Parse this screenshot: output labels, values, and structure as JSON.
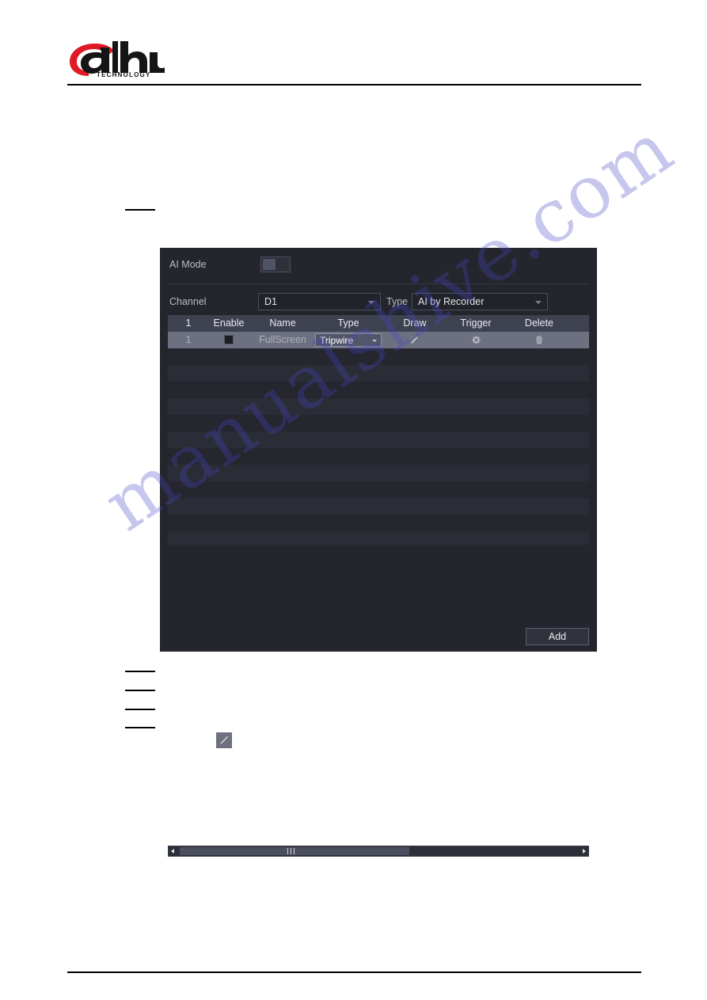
{
  "document": {
    "brand": "alhua",
    "brand_sub": "TECHNOLOGY"
  },
  "dialog": {
    "ai_mode": {
      "label": "AI Mode",
      "toggle_state": "off"
    },
    "channel": {
      "label": "Channel",
      "value": "D1"
    },
    "type": {
      "label": "Type",
      "value": "AI by Recorder"
    },
    "table": {
      "headers": [
        "1",
        "Enable",
        "Name",
        "Type",
        "Draw",
        "Trigger",
        "Delete"
      ],
      "rows": [
        {
          "index": "1",
          "enable": "checked",
          "name": "FullScreen",
          "type": "Tripwire",
          "draw": "pencil-icon",
          "trigger": "gear-icon",
          "delete": "trash-icon"
        }
      ],
      "empty_row_count": 15
    },
    "add_button": {
      "label": "Add"
    },
    "scrollbar": {
      "orientation": "horizontal",
      "left_arrow": "chevron-left-icon",
      "right_arrow": "chevron-right-icon"
    }
  },
  "watermark": {
    "text": "manualshive.com"
  },
  "colors": {
    "dialog_bg": "#25262d",
    "header_row": "#3e4250",
    "selected_row": "#6d7080",
    "accent_red": "#e01a24",
    "text_primary": "#e8eaf0",
    "text_muted": "#b9bcc6"
  }
}
